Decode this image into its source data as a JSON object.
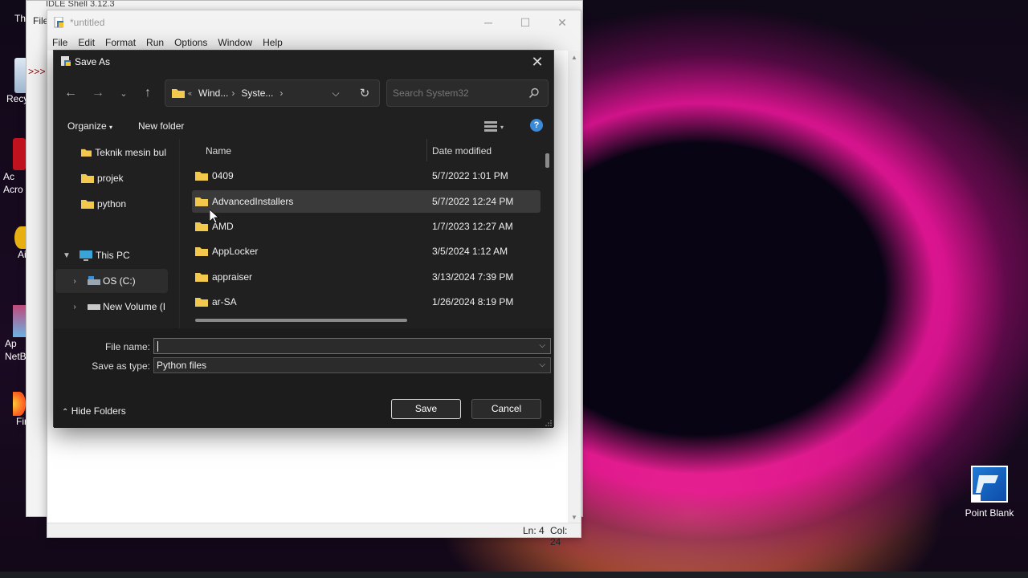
{
  "desktop": {
    "left_icons": [
      "Th",
      "Recy",
      "Ac Acro",
      "Ai",
      "Ap NetB",
      "Fir"
    ],
    "point_blank_label": "Point Blank"
  },
  "shell_window": {
    "title": "IDLE Shell 3.12.3",
    "menu_partial": "File",
    "prompt": ">>>"
  },
  "editor": {
    "title": "*untitled",
    "menu": [
      "File",
      "Edit",
      "Format",
      "Run",
      "Options",
      "Window",
      "Help"
    ],
    "status": {
      "line": "Ln: 4",
      "col": "Col: 24"
    }
  },
  "dialog": {
    "title": "Save As",
    "breadcrumbs": [
      "Wind...",
      "Syste..."
    ],
    "search_placeholder": "Search System32",
    "toolbar": {
      "organize": "Organize",
      "new_folder": "New folder"
    },
    "nav_items": [
      {
        "label": "Teknik mesin bul",
        "type": "folder"
      },
      {
        "label": "projek",
        "type": "folder"
      },
      {
        "label": "python",
        "type": "folder"
      },
      {
        "label": "This PC",
        "type": "pc"
      },
      {
        "label": "OS (C:)",
        "type": "drive"
      },
      {
        "label": "New Volume (I",
        "type": "drive"
      }
    ],
    "columns": {
      "name": "Name",
      "date": "Date modified"
    },
    "files": [
      {
        "name": "0409",
        "date": "5/7/2022 1:01 PM"
      },
      {
        "name": "AdvancedInstallers",
        "date": "5/7/2022 12:24 PM"
      },
      {
        "name": "AMD",
        "date": "1/7/2023 12:27 AM"
      },
      {
        "name": "AppLocker",
        "date": "3/5/2024 1:12 AM"
      },
      {
        "name": "appraiser",
        "date": "3/13/2024 7:39 PM"
      },
      {
        "name": "ar-SA",
        "date": "1/26/2024 8:19 PM"
      }
    ],
    "file_name_label": "File name:",
    "file_name_value": "",
    "save_type_label": "Save as type:",
    "save_type_value": "Python files",
    "hide_folders": "Hide Folders",
    "save_button": "Save",
    "cancel_button": "Cancel"
  },
  "colors": {
    "dialog_bg": "#202020",
    "accent_folder": "#f2c94c",
    "help_blue": "#3b8ad8"
  }
}
